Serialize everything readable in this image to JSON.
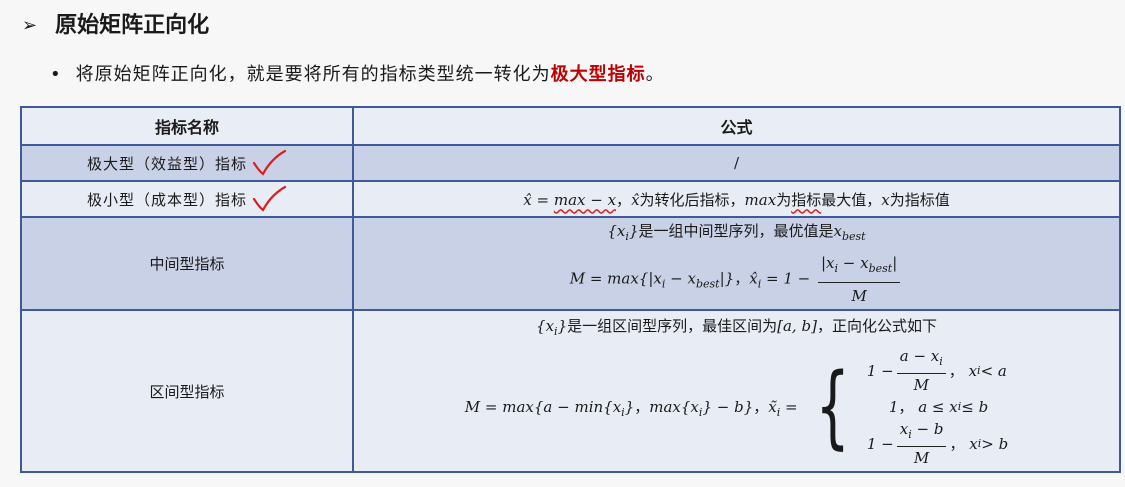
{
  "heading": {
    "arrow": "➢",
    "title": "原始矩阵正向化"
  },
  "bullet": {
    "dot": "•",
    "text": "将原始矩阵正向化，就是要将所有的指标类型统一转化为",
    "highlight": "极大型指标",
    "end": "。"
  },
  "table": {
    "headers": [
      "指标名称",
      "公式"
    ],
    "rows": [
      {
        "name": "极大型（效益型）指标",
        "formula": "/"
      },
      {
        "name": "极小型（成本型）指标",
        "formula_desc": "x̂ = max − x，x̂为转化后指标，max为指标最大值，x为指标值"
      },
      {
        "name": "中间型指标",
        "formula_line1": "{xi}是一组中间型序列，最优值是xbest",
        "formula_line2": "M = max{|xi − xbest|}，x̂i = 1 − |xi − xbest| / M"
      },
      {
        "name": "区间型指标",
        "formula_line1": "{xi}是一组区间型序列，最佳区间为[a, b]，正向化公式如下",
        "formula_line2": "M = max{a − min{xi}，max{xi} − b}"
      }
    ]
  },
  "colors": {
    "border": "#3f5a9a",
    "row_dark": "#c9d1e6",
    "row_light": "#e8ecf5",
    "highlight": "#c00000",
    "annotation": "#d92020"
  }
}
